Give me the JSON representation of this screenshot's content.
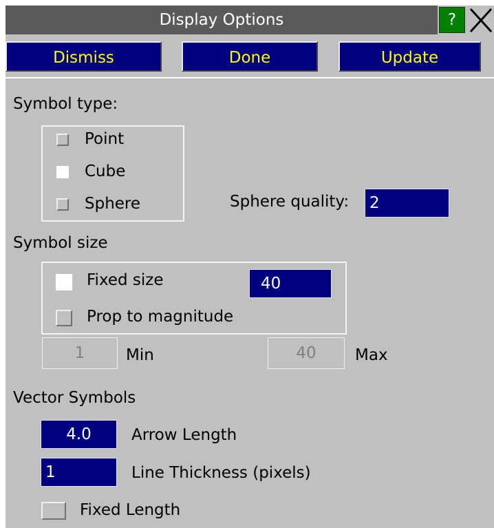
{
  "window": {
    "title": "Display Options",
    "help_label": "?",
    "close_icon": "close-icon"
  },
  "buttons": {
    "dismiss": "Dismiss",
    "done": "Done",
    "update": "Update"
  },
  "symbol_type": {
    "heading": "Symbol type:",
    "options": [
      {
        "label": "Point",
        "selected": false
      },
      {
        "label": "Cube",
        "selected": true
      },
      {
        "label": "Sphere",
        "selected": false
      }
    ],
    "sphere_quality_label": "Sphere quality:",
    "sphere_quality_value": "2"
  },
  "symbol_size": {
    "heading": "Symbol size",
    "fixed_size_label": "Fixed size",
    "fixed_size_checked": true,
    "fixed_size_value": "40",
    "prop_label": "Prop to magnitude",
    "prop_checked": false,
    "min_value": "1",
    "min_label": "Min",
    "max_value": "40",
    "max_label": "Max"
  },
  "vector_symbols": {
    "heading": "Vector Symbols",
    "arrow_length_value": "4.0",
    "arrow_length_label": "Arrow Length",
    "line_thickness_value": "1",
    "line_thickness_label": "Line Thickness (pixels)",
    "fixed_length_label": "Fixed Length",
    "fixed_length_checked": false
  },
  "colors": {
    "panel": "#c0c0c0",
    "titlebar": "#5a5a5a",
    "button_bg": "#000080",
    "button_text": "#ffff00",
    "help_bg": "#008000"
  }
}
